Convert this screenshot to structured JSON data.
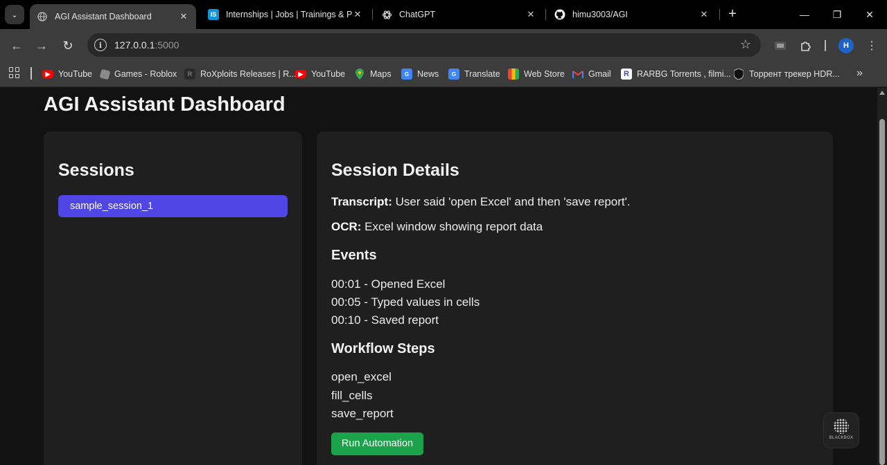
{
  "browser": {
    "tabs": [
      {
        "title": "AGI Assistant Dashboard",
        "active": true,
        "icon": "globe-icon"
      },
      {
        "title": "Internships | Jobs | Trainings & Pla",
        "active": false,
        "icon": "internshala-icon",
        "icon_text": "IS"
      },
      {
        "title": "ChatGPT",
        "active": false,
        "icon": "openai-icon"
      },
      {
        "title": "himu3003/AGI",
        "active": false,
        "icon": "github-icon"
      }
    ],
    "url_host": "127.0.0.1",
    "url_port": ":5000",
    "profile_initial": "H",
    "bookmarks": [
      {
        "label": "YouTube",
        "icon": "youtube-icon",
        "color": "#ff0000"
      },
      {
        "label": "Games - Roblox",
        "icon": "roblox-icon",
        "color": "#888888"
      },
      {
        "label": "RoXploits Releases | R...",
        "icon": "roxploits-icon",
        "color": "#444444"
      },
      {
        "label": "YouTube",
        "icon": "youtube-icon",
        "color": "#ff0000"
      },
      {
        "label": "Maps",
        "icon": "maps-icon",
        "color": "#34a853"
      },
      {
        "label": "News",
        "icon": "news-icon",
        "color": "#4285f4"
      },
      {
        "label": "Translate",
        "icon": "translate-icon",
        "color": "#4285f4"
      },
      {
        "label": "Web Store",
        "icon": "webstore-icon",
        "color": "#ea4335"
      },
      {
        "label": "Gmail",
        "icon": "gmail-icon",
        "color": "#ea4335"
      },
      {
        "label": "RARBG Torrents , filmi...",
        "icon": "rarbg-icon",
        "color": "#3b4aa8"
      },
      {
        "label": "Торрент трекер HDR...",
        "icon": "shield-icon",
        "color": "#222222"
      }
    ]
  },
  "dashboard": {
    "title": "AGI Assistant Dashboard",
    "sessions": {
      "heading": "Sessions",
      "items": [
        "sample_session_1"
      ]
    },
    "details": {
      "heading": "Session Details",
      "transcript_label": "Transcript:",
      "transcript": " User said 'open Excel' and then 'save report'.",
      "ocr_label": "OCR:",
      "ocr": " Excel window showing report data",
      "events_heading": "Events",
      "events": [
        "00:01 - Opened Excel",
        "00:05 - Typed values in cells",
        "00:10 - Saved report"
      ],
      "workflow_heading": "Workflow Steps",
      "workflow": [
        "open_excel",
        "fill_cells",
        "save_report"
      ],
      "run_button": "Run Automation"
    },
    "widget_label": "BLACKBOX"
  },
  "colors": {
    "accent": "#4f46e5",
    "run": "#1aa34a",
    "card": "#1f1f1f",
    "page": "#121212"
  }
}
